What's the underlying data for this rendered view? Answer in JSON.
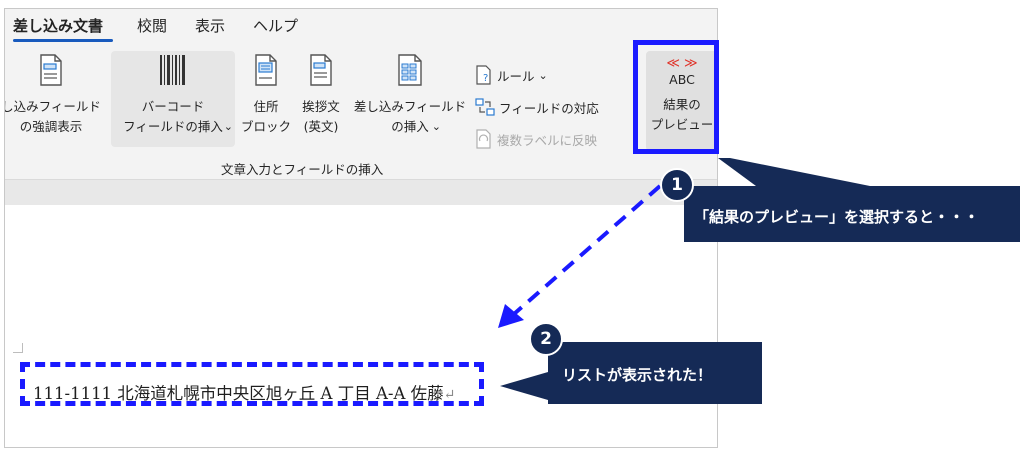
{
  "tabs": [
    {
      "label": "差し込み文書",
      "active": true
    },
    {
      "label": "校閲"
    },
    {
      "label": "表示"
    },
    {
      "label": "ヘルプ"
    }
  ],
  "ribbon": {
    "highlight_fields": "し込みフィールド\nの強調表示",
    "barcode_field": "バーコード\nフィールドの挿入",
    "address_block": "住所\nブロック",
    "greeting_line": "挨拶文\n(英文)",
    "insert_merge_field": "差し込みフィールド\nの挿入",
    "rules": "ルール",
    "match_fields": "フィールドの対応",
    "update_labels": "複数ラベルに反映",
    "group_label": "文章入力とフィールドの挿入",
    "preview_icon_text": "ABC",
    "preview_arrows": "≪ ≫",
    "preview_results": "結果の\nプレビュー"
  },
  "document": {
    "line": "111-1111 北海道札幌市中央区旭ヶ丘 A 丁目 A-A 佐藤",
    "para_mark": "↵"
  },
  "annotations": {
    "step1_num": "1",
    "step1_text": "「結果のプレビュー」を選択すると・・・",
    "step2_num": "2",
    "step2_text": "リストが表示された！"
  },
  "colors": {
    "accent_blue": "#1a1aff",
    "callout_navy": "#152a56",
    "tab_underline": "#185abd"
  }
}
